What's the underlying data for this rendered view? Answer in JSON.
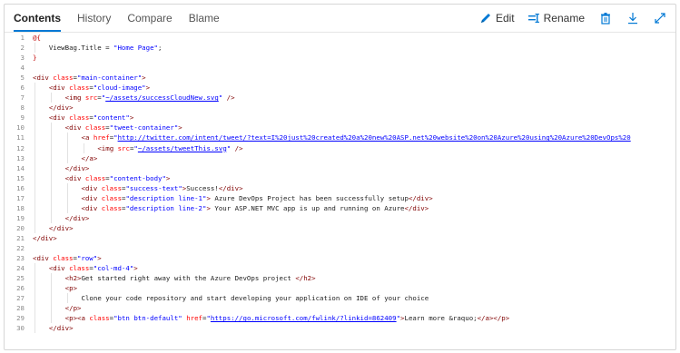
{
  "tabs": [
    {
      "label": "Contents",
      "active": true
    },
    {
      "label": "History",
      "active": false
    },
    {
      "label": "Compare",
      "active": false
    },
    {
      "label": "Blame",
      "active": false
    }
  ],
  "actions": {
    "edit_label": "Edit",
    "rename_label": "Rename",
    "edit_icon": "pencil-icon",
    "rename_icon": "rename-icon",
    "delete_icon": "trash-icon",
    "download_icon": "download-icon",
    "fullscreen_icon": "expand-icon"
  },
  "colors": {
    "accent": "#0078d4",
    "tag": "#800000",
    "attribute": "#ff0000",
    "string": "#0000ff",
    "razor": "#c00000"
  },
  "code_lines": [
    {
      "n": "1",
      "indent": 0,
      "parts": [
        [
          "r",
          "@{"
        ]
      ]
    },
    {
      "n": "2",
      "indent": 4,
      "parts": [
        [
          "t",
          "ViewBag.Title = "
        ],
        [
          "s",
          "\"Home Page\""
        ],
        [
          "t",
          ";"
        ]
      ]
    },
    {
      "n": "3",
      "indent": 0,
      "parts": [
        [
          "r",
          "}"
        ]
      ]
    },
    {
      "n": "4",
      "indent": 0,
      "parts": []
    },
    {
      "n": "5",
      "indent": 0,
      "parts": [
        [
          "k",
          "<div "
        ],
        [
          "a",
          "class"
        ],
        [
          "t",
          "="
        ],
        [
          "s",
          "\"main-container\""
        ],
        [
          "k",
          ">"
        ]
      ]
    },
    {
      "n": "6",
      "indent": 4,
      "parts": [
        [
          "k",
          "<div "
        ],
        [
          "a",
          "class"
        ],
        [
          "t",
          "="
        ],
        [
          "s",
          "\"cloud-image\""
        ],
        [
          "k",
          ">"
        ]
      ]
    },
    {
      "n": "7",
      "indent": 8,
      "parts": [
        [
          "k",
          "<img "
        ],
        [
          "a",
          "src"
        ],
        [
          "t",
          "="
        ],
        [
          "s",
          "\""
        ],
        [
          "l",
          "~/assets/successCloudNew.svg"
        ],
        [
          "s",
          "\""
        ],
        [
          "k",
          " />"
        ]
      ]
    },
    {
      "n": "8",
      "indent": 4,
      "parts": [
        [
          "k",
          "</div>"
        ]
      ]
    },
    {
      "n": "9",
      "indent": 4,
      "parts": [
        [
          "k",
          "<div "
        ],
        [
          "a",
          "class"
        ],
        [
          "t",
          "="
        ],
        [
          "s",
          "\"content\""
        ],
        [
          "k",
          ">"
        ]
      ]
    },
    {
      "n": "10",
      "indent": 8,
      "parts": [
        [
          "k",
          "<div "
        ],
        [
          "a",
          "class"
        ],
        [
          "t",
          "="
        ],
        [
          "s",
          "\"tweet-container\""
        ],
        [
          "k",
          ">"
        ]
      ]
    },
    {
      "n": "11",
      "indent": 12,
      "parts": [
        [
          "k",
          "<a "
        ],
        [
          "a",
          "href"
        ],
        [
          "t",
          "="
        ],
        [
          "s",
          "\""
        ],
        [
          "l",
          "http://twitter.com/intent/tweet/?text=I%20just%20created%20a%20new%20ASP.net%20website%20on%20Azure%20using%20Azure%20DevOps%20"
        ]
      ]
    },
    {
      "n": "12",
      "indent": 16,
      "parts": [
        [
          "k",
          "<img "
        ],
        [
          "a",
          "src"
        ],
        [
          "t",
          "="
        ],
        [
          "s",
          "\""
        ],
        [
          "l",
          "~/assets/tweetThis.svg"
        ],
        [
          "s",
          "\""
        ],
        [
          "k",
          " />"
        ]
      ]
    },
    {
      "n": "13",
      "indent": 12,
      "parts": [
        [
          "k",
          "</a>"
        ]
      ]
    },
    {
      "n": "14",
      "indent": 8,
      "parts": [
        [
          "k",
          "</div>"
        ]
      ]
    },
    {
      "n": "15",
      "indent": 8,
      "parts": [
        [
          "k",
          "<div "
        ],
        [
          "a",
          "class"
        ],
        [
          "t",
          "="
        ],
        [
          "s",
          "\"content-body\""
        ],
        [
          "k",
          ">"
        ]
      ]
    },
    {
      "n": "16",
      "indent": 12,
      "parts": [
        [
          "k",
          "<div "
        ],
        [
          "a",
          "class"
        ],
        [
          "t",
          "="
        ],
        [
          "s",
          "\"success-text\""
        ],
        [
          "k",
          ">"
        ],
        [
          "t",
          "Success!"
        ],
        [
          "k",
          "</div>"
        ]
      ]
    },
    {
      "n": "17",
      "indent": 12,
      "parts": [
        [
          "k",
          "<div "
        ],
        [
          "a",
          "class"
        ],
        [
          "t",
          "="
        ],
        [
          "s",
          "\"description line-1\""
        ],
        [
          "k",
          ">"
        ],
        [
          "t",
          " Azure DevOps Project has been successfully setup"
        ],
        [
          "k",
          "</div>"
        ]
      ]
    },
    {
      "n": "18",
      "indent": 12,
      "parts": [
        [
          "k",
          "<div "
        ],
        [
          "a",
          "class"
        ],
        [
          "t",
          "="
        ],
        [
          "s",
          "\"description line-2\""
        ],
        [
          "k",
          ">"
        ],
        [
          "t",
          " Your ASP.NET MVC app is up and running on Azure"
        ],
        [
          "k",
          "</div>"
        ]
      ]
    },
    {
      "n": "19",
      "indent": 8,
      "parts": [
        [
          "k",
          "</div>"
        ]
      ]
    },
    {
      "n": "20",
      "indent": 4,
      "parts": [
        [
          "k",
          "</div>"
        ]
      ]
    },
    {
      "n": "21",
      "indent": 0,
      "parts": [
        [
          "k",
          "</div>"
        ]
      ]
    },
    {
      "n": "22",
      "indent": 0,
      "parts": []
    },
    {
      "n": "23",
      "indent": 0,
      "parts": [
        [
          "k",
          "<div "
        ],
        [
          "a",
          "class"
        ],
        [
          "t",
          "="
        ],
        [
          "s",
          "\"row\""
        ],
        [
          "k",
          ">"
        ]
      ]
    },
    {
      "n": "24",
      "indent": 4,
      "parts": [
        [
          "k",
          "<div "
        ],
        [
          "a",
          "class"
        ],
        [
          "t",
          "="
        ],
        [
          "s",
          "\"col-md-4\""
        ],
        [
          "k",
          ">"
        ]
      ]
    },
    {
      "n": "25",
      "indent": 8,
      "parts": [
        [
          "k",
          "<h2>"
        ],
        [
          "t",
          "Get started right away with the Azure DevOps project "
        ],
        [
          "k",
          "</h2>"
        ]
      ]
    },
    {
      "n": "26",
      "indent": 8,
      "parts": [
        [
          "k",
          "<p>"
        ]
      ]
    },
    {
      "n": "27",
      "indent": 12,
      "parts": [
        [
          "t",
          "Clone your code repository and start developing your application on IDE of your choice"
        ]
      ]
    },
    {
      "n": "28",
      "indent": 8,
      "parts": [
        [
          "k",
          "</p>"
        ]
      ]
    },
    {
      "n": "29",
      "indent": 8,
      "parts": [
        [
          "k",
          "<p><a "
        ],
        [
          "a",
          "class"
        ],
        [
          "t",
          "="
        ],
        [
          "s",
          "\"btn btn-default\""
        ],
        [
          "t",
          " "
        ],
        [
          "a",
          "href"
        ],
        [
          "t",
          "="
        ],
        [
          "s",
          "\""
        ],
        [
          "l",
          "https://go.microsoft.com/fwlink/?linkid=862409"
        ],
        [
          "s",
          "\""
        ],
        [
          "k",
          ">"
        ],
        [
          "t",
          "Learn more &raquo;"
        ],
        [
          "k",
          "</a></p>"
        ]
      ]
    },
    {
      "n": "30",
      "indent": 4,
      "parts": [
        [
          "k",
          "</div>"
        ]
      ]
    }
  ]
}
